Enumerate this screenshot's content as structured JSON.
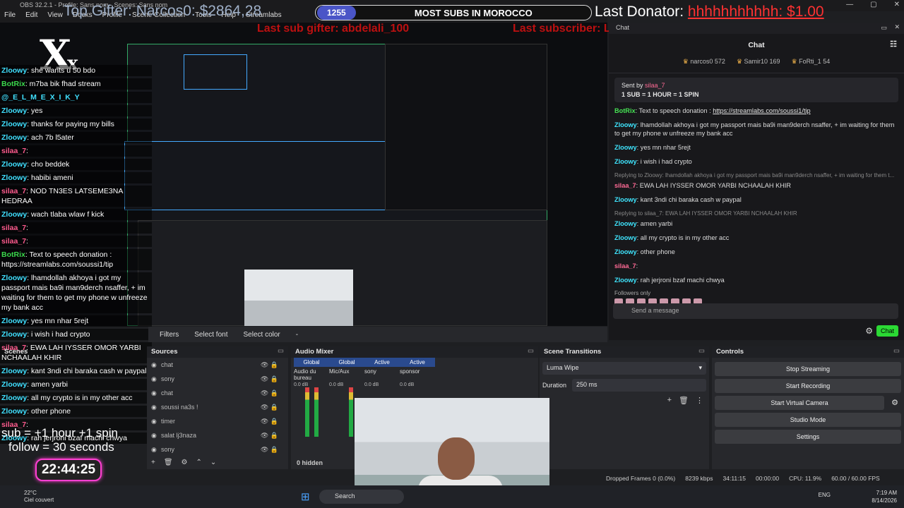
{
  "window": {
    "title": "OBS 32.2.1 - Profile: Sans nom - Scenes: Sans nom"
  },
  "menu": [
    "File",
    "Edit",
    "View",
    "Docks",
    "Profile",
    "Scene Collection",
    "Tools",
    "Help",
    "Streamlabs"
  ],
  "overlay": {
    "top_gifter": "Top Gifter: Narcos0: $2864,28",
    "subs_count": "1255",
    "subs_goal": "MOST SUBS IN MOROCCO",
    "last_donator_label": "Last Donator:",
    "last_donator_value": "hhhhhhhhhhh: $1.00",
    "last_sub_gifter": "Last sub gifter: abdelali_100",
    "last_subscriber": "Last subscriber: LAST_ahidou_y",
    "logo": "X",
    "logo_small": "x",
    "sub_rule": "sub  = +1 hour +1 spin",
    "follow_rule": "follow = 30 seconds",
    "timer": "22:44:25"
  },
  "left_chat": [
    {
      "user": "Zloowy",
      "color": "u",
      "text": ": she wants u 50 bdo"
    },
    {
      "user": "BotRix",
      "color": "g",
      "text": ": m7ba bik fhad stream"
    },
    {
      "user": "@_E_L_M_E_X_I_K_Y",
      "color": "u",
      "text": ""
    },
    {
      "user": "Zloowy",
      "color": "u",
      "text": ": yes"
    },
    {
      "user": "Zloowy",
      "color": "u",
      "text": ": thanks for paying my bills"
    },
    {
      "user": "Zloowy",
      "color": "u",
      "text": ": ach 7b l5ater"
    },
    {
      "user": "silaa_7",
      "color": "p",
      "text": ":"
    },
    {
      "user": "Zloowy",
      "color": "u",
      "text": ": cho beddek"
    },
    {
      "user": "Zloowy",
      "color": "u",
      "text": ": habibi ameni"
    },
    {
      "user": "silaa_7",
      "color": "p",
      "text": ": NOD TN3ES LATSEME3NA HEDRAA"
    },
    {
      "user": "Zloowy",
      "color": "u",
      "text": ": wach tlaba wlaw f kick"
    },
    {
      "user": "silaa_7",
      "color": "p",
      "text": ":"
    },
    {
      "user": "silaa_7",
      "color": "p",
      "text": ":"
    },
    {
      "user": "BotRix",
      "color": "g",
      "text": ": Text to speech donation : https://streamlabs.com/soussi1/tip"
    },
    {
      "user": "Zloowy",
      "color": "u",
      "text": ": lhamdollah akhoya i got my passport mais ba9i man9derch nsaffer, + im waiting for them to get my phone w unfreeze my bank acc"
    },
    {
      "user": "Zloowy",
      "color": "u",
      "text": ": yes mn nhar 5rejt"
    },
    {
      "user": "Zloowy",
      "color": "u",
      "text": ": i wish i had crypto"
    },
    {
      "user": "silaa_7",
      "color": "p",
      "text": ": EWA LAH IYSSER OMOR YARBI NCHAALAH KHIR"
    },
    {
      "user": "Zloowy",
      "color": "u",
      "text": ": kant 3ndi chi baraka cash w paypal"
    },
    {
      "user": "Zloowy",
      "color": "u",
      "text": ": amen yarbi"
    },
    {
      "user": "Zloowy",
      "color": "u",
      "text": ": all my crypto is in my other acc"
    },
    {
      "user": "Zloowy",
      "color": "u",
      "text": ": other phone"
    },
    {
      "user": "silaa_7",
      "color": "p",
      "text": ":"
    },
    {
      "user": "Zloowy",
      "color": "u",
      "text": ": rah jerjroni bzaf machi chwya"
    }
  ],
  "filterbar": {
    "filters": "Filters",
    "select_font": "Select font",
    "select_color": "Select color",
    "dash": "-"
  },
  "chat_panel": {
    "header": "Chat",
    "tab": "Chat",
    "leaders": [
      {
        "name": "narcos0",
        "score": "572"
      },
      {
        "name": "Samir10",
        "score": "169"
      },
      {
        "name": "FoRti_1",
        "score": "54"
      }
    ],
    "pinned_by": "Sent by",
    "pinned_user": "silaa_7",
    "pinned_text": "1 SUB = 1 HOUR = 1 SPIN",
    "messages": [
      {
        "reply": "",
        "user": "BotRix",
        "color": "g",
        "text": ": Text to speech donation : ",
        "link": "https://streamlabs.com/soussi1/tip"
      },
      {
        "reply": "",
        "user": "Zloowy",
        "color": "u",
        "text": ": lhamdollah akhoya i got my passport mais ba9i man9derch nsaffer, + im waiting for them to get my phone w unfreeze my bank acc",
        "link": ""
      },
      {
        "reply": "",
        "user": "Zloowy",
        "color": "u",
        "text": ": yes mn nhar 5rejt",
        "link": ""
      },
      {
        "reply": "",
        "user": "Zloowy",
        "color": "u",
        "text": ": i wish i had crypto",
        "link": ""
      },
      {
        "reply": "Replying to Zloowy: lhamdollah akhoya i got my passport mais ba9i man9derch nsaffer, + im waiting for them t...",
        "user": "silaa_7",
        "color": "p",
        "text": ": EWA LAH IYSSER OMOR YARBI NCHAALAH KHIR",
        "link": ""
      },
      {
        "reply": "",
        "user": "Zloowy",
        "color": "u",
        "text": ": kant 3ndi chi baraka cash w paypal",
        "link": ""
      },
      {
        "reply": "Replying to silaa_7: EWA LAH IYSSER OMOR YARBI NCHAALAH KHIR",
        "user": "Zloowy",
        "color": "u",
        "text": ": amen yarbi",
        "link": ""
      },
      {
        "reply": "",
        "user": "Zloowy",
        "color": "u",
        "text": ": all my crypto is in my other acc",
        "link": ""
      },
      {
        "reply": "",
        "user": "Zloowy",
        "color": "u",
        "text": ": other phone",
        "link": ""
      },
      {
        "reply": "",
        "user": "silaa_7",
        "color": "p",
        "text": ":",
        "link": ""
      },
      {
        "reply": "",
        "user": "Zloowy",
        "color": "u",
        "text": ": rah jerjroni bzaf machi chwya",
        "link": ""
      }
    ],
    "followers_only": "Followers only",
    "send_placeholder": "Send a message",
    "chat_button": "Chat"
  },
  "scenes": {
    "title": "Scenes"
  },
  "sources": {
    "title": "Sources",
    "items": [
      "chat",
      "sony",
      "chat",
      "soussi na3s !",
      "timer",
      "salat lj3naza",
      "sony"
    ]
  },
  "mixer": {
    "title": "Audio Mixer",
    "tabs": [
      "Global",
      "Global",
      "Active",
      "Active"
    ],
    "channels": [
      "Audio du bureau",
      "Mic/Aux",
      "sony",
      "sponsor"
    ],
    "db": "0.0 dB",
    "hidden": "0 hidden"
  },
  "transitions": {
    "title": "Scene Transitions",
    "selected": "Luma Wipe",
    "duration_label": "Duration",
    "duration_value": "250 ms"
  },
  "controls": {
    "title": "Controls",
    "buttons": [
      "Stop Streaming",
      "Start Recording",
      "Start Virtual Camera",
      "Studio Mode",
      "Settings"
    ]
  },
  "status": {
    "dropped": "Dropped Frames 0 (0.0%)",
    "bitrate": "8239 kbps",
    "live_time": "34:11:15",
    "rec_time": "00:00:00",
    "cpu": "CPU: 11.9%",
    "fps": "60.00 / 60.00 FPS"
  },
  "taskbar": {
    "temp": "22°C",
    "weather": "Ciel couvert",
    "search": "Search",
    "lang": "ENG",
    "time": "7:19 AM",
    "date": "8/14/2026"
  },
  "colors": {
    "accent": "#2bd934",
    "subs_pill": "#4a55c7",
    "timer_glow": "#ff3fd2"
  }
}
